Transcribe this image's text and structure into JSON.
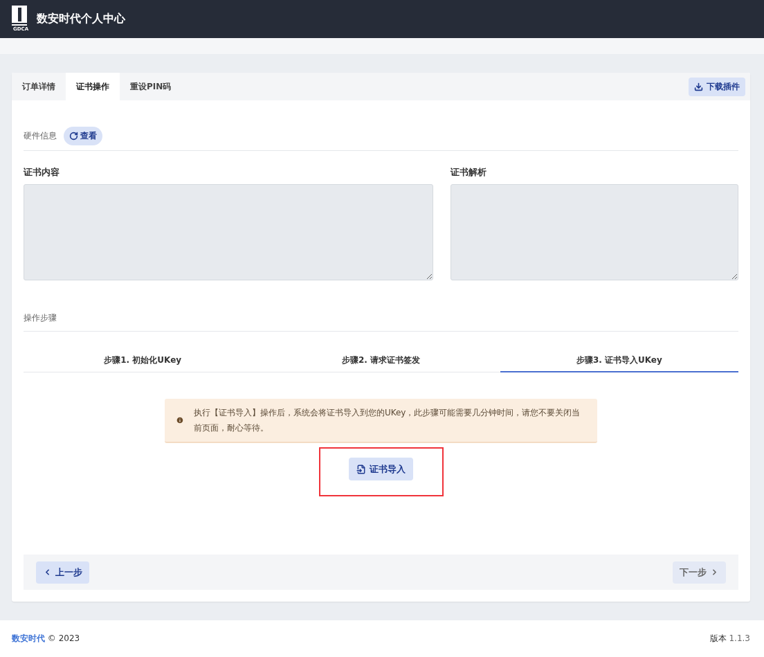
{
  "header": {
    "logo_text": "GDCA",
    "title": "数安时代个人中心"
  },
  "tabs": [
    {
      "label": "订单详情",
      "selected": false
    },
    {
      "label": "证书操作",
      "selected": true
    },
    {
      "label": "重设PIN码",
      "selected": false
    }
  ],
  "download_button": "下载插件",
  "hardware": {
    "label": "硬件信息",
    "button": "查看"
  },
  "panels": [
    {
      "label": "证书内容"
    },
    {
      "label": "证书解析"
    }
  ],
  "steps_heading": "操作步骤",
  "steps": [
    {
      "label": "步骤1. 初始化UKey",
      "selected": false
    },
    {
      "label": "步骤2. 请求证书签发",
      "selected": false
    },
    {
      "label": "步骤3. 证书导入UKey",
      "selected": true
    }
  ],
  "notice": "执行【证书导入】操作后，系统会将证书导入到您的UKey，此步骤可能需要几分钟时间，请您不要关闭当前页面，耐心等待。",
  "import_button": "证书导入",
  "prev_button": {
    "label": "上一步",
    "disabled": false
  },
  "next_button": {
    "label": "下一步",
    "disabled": true
  },
  "footer": {
    "brand": "数安时代",
    "copyright": "© 2023",
    "version_label": "版本",
    "version": "1.1.3"
  }
}
